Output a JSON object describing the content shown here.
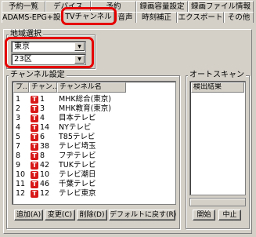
{
  "tabs": {
    "row_back": [
      "予約一覧",
      "デバイス",
      "予約",
      "録画容量設定",
      "録画ファイル情報"
    ],
    "row_front": [
      "ADAMS-EPG+設定",
      "TVチャンネル",
      "音声",
      "時刻補正",
      "エクスポート",
      "その他"
    ],
    "active": "TVチャンネル"
  },
  "region": {
    "group_label": "地域選択",
    "prefecture": "東京",
    "area": "23区"
  },
  "channels": {
    "group_label": "チャンネル設定",
    "columns": [
      "プ..",
      "チャン..",
      "チャンネル名"
    ],
    "rows": [
      {
        "pos": "1",
        "ch": "1",
        "name": "MHK総合(東京)"
      },
      {
        "pos": "2",
        "ch": "3",
        "name": "MHK教育(東京)"
      },
      {
        "pos": "3",
        "ch": "4",
        "name": "目本テレビ"
      },
      {
        "pos": "4",
        "ch": "14",
        "name": "NYテレビ"
      },
      {
        "pos": "5",
        "ch": "6",
        "name": "T85テレビ"
      },
      {
        "pos": "7",
        "ch": "38",
        "name": "テレビ埼玉"
      },
      {
        "pos": "8",
        "ch": "8",
        "name": "フヂテレビ"
      },
      {
        "pos": "9",
        "ch": "42",
        "name": "TUKテレビ"
      },
      {
        "pos": "10",
        "ch": "10",
        "name": "テレビ潮日"
      },
      {
        "pos": "11",
        "ch": "46",
        "name": "千葉テレビ"
      },
      {
        "pos": "12",
        "ch": "12",
        "name": "テレビ東京"
      }
    ],
    "buttons": {
      "add": "追加(A)",
      "change": "変更(C)",
      "delete": "削除(D)",
      "default": "デフォルトに戻す(R)"
    }
  },
  "autoscan": {
    "group_label": "オートスキャン",
    "column": "検出結果",
    "start": "開始",
    "stop": "中止"
  },
  "colors": {
    "highlight": "#e60000",
    "channel_logo": "#d81818",
    "window_bg": "#d4d0c8"
  }
}
